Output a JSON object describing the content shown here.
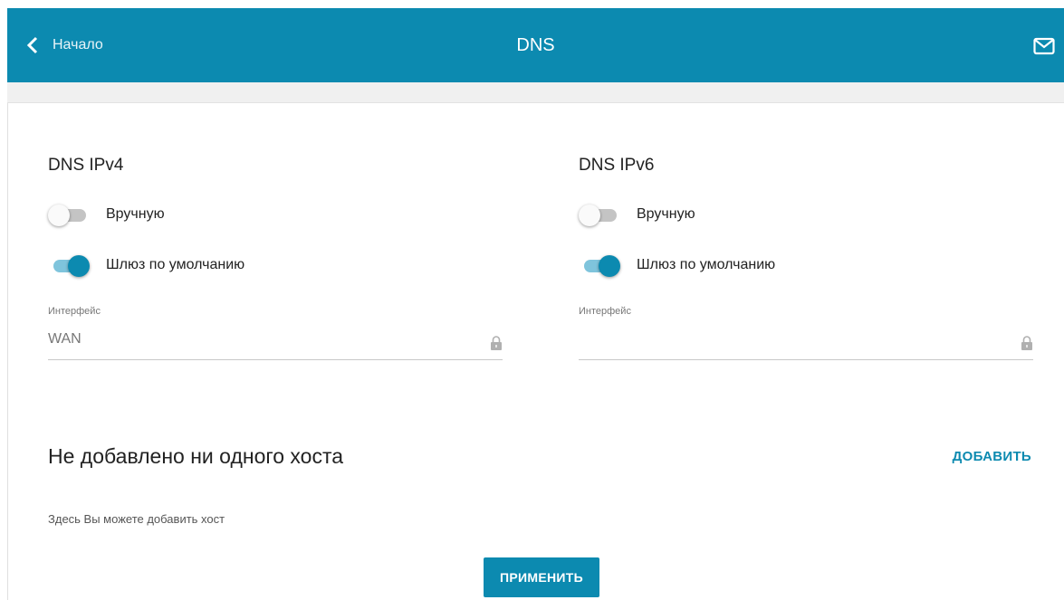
{
  "header": {
    "back_label": "Начало",
    "title": "DNS",
    "mail_icon": "mail-icon",
    "color": "#0c8ab0"
  },
  "ipv4": {
    "title": "DNS IPv4",
    "manual_label": "Вручную",
    "manual_on": false,
    "gateway_label": "Шлюз по умолчанию",
    "gateway_on": true,
    "interface_label": "Интерфейс",
    "interface_value": "WAN"
  },
  "ipv6": {
    "title": "DNS IPv6",
    "manual_label": "Вручную",
    "manual_on": false,
    "gateway_label": "Шлюз по умолчанию",
    "gateway_on": true,
    "interface_label": "Интерфейс",
    "interface_value": ""
  },
  "hosts": {
    "title": "Не добавлено ни одного хоста",
    "add_label": "ДОБАВИТЬ",
    "hint": "Здесь Вы можете добавить хост"
  },
  "apply_label": "ПРИМЕНИТЬ"
}
